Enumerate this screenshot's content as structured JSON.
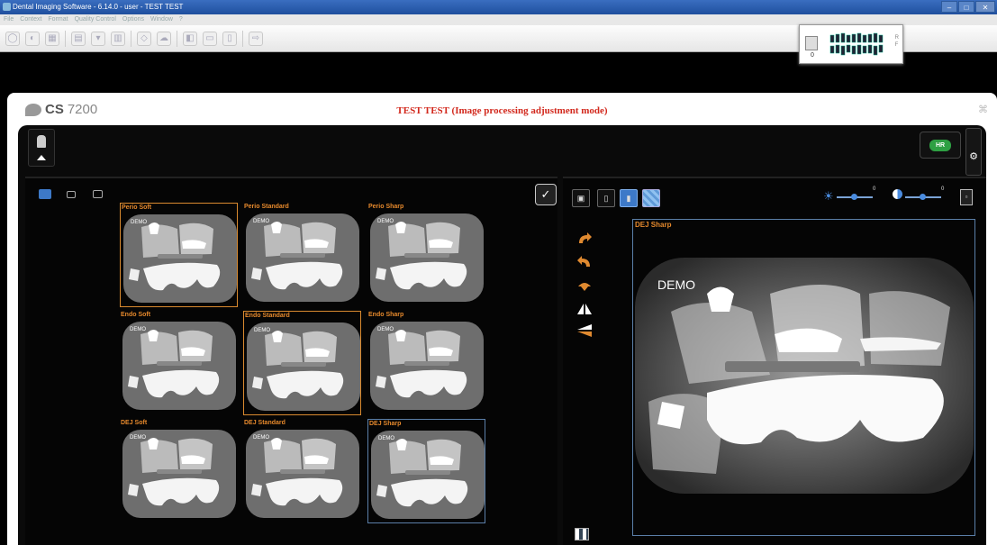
{
  "window": {
    "title": "Dental Imaging Software - 6.14.0 - user - TEST TEST",
    "min": "–",
    "max": "□",
    "close": "✕"
  },
  "menu": [
    "File",
    "Context",
    "Format",
    "Quality Control",
    "Options",
    "Window",
    "?"
  ],
  "toolbar_icons": [
    "open-icon",
    "acquire-icon",
    "series-icon",
    "layout-icon",
    "dropdown-icon",
    "grid-icon",
    "eraser-icon",
    "cloud-icon",
    "sensor-icon",
    "screen-icon",
    "monitor-icon",
    "export-icon"
  ],
  "teeth_widget": {
    "number": "0",
    "side_top": "R",
    "side_bottom": "F"
  },
  "panel": {
    "brand_cs": "CS",
    "brand_model": "7200",
    "title": "TEST TEST (Image processing adjustment mode)",
    "close": "⌘"
  },
  "hr_button": "HR",
  "thumbnails": [
    {
      "label": "Perio Soft",
      "state": "orange"
    },
    {
      "label": "Perio Standard",
      "state": "none"
    },
    {
      "label": "Perio Sharp",
      "state": "none"
    },
    {
      "label": "Endo Soft",
      "state": "none"
    },
    {
      "label": "Endo Standard",
      "state": "orange"
    },
    {
      "label": "Endo Sharp",
      "state": "none"
    },
    {
      "label": "DEJ Soft",
      "state": "none"
    },
    {
      "label": "DEJ Standard",
      "state": "none"
    },
    {
      "label": "DEJ Sharp",
      "state": "blue"
    }
  ],
  "thumb_watermark": "DEMO",
  "preview": {
    "label": "DEJ Sharp",
    "watermark": "DEMO"
  },
  "brightness": {
    "value": "0"
  },
  "contrast": {
    "value": "0"
  },
  "colors": {
    "accent_orange": "#e6892c",
    "title_red": "#d2281c",
    "select_blue": "#5b7fa8",
    "hr_green": "#2ea043"
  }
}
